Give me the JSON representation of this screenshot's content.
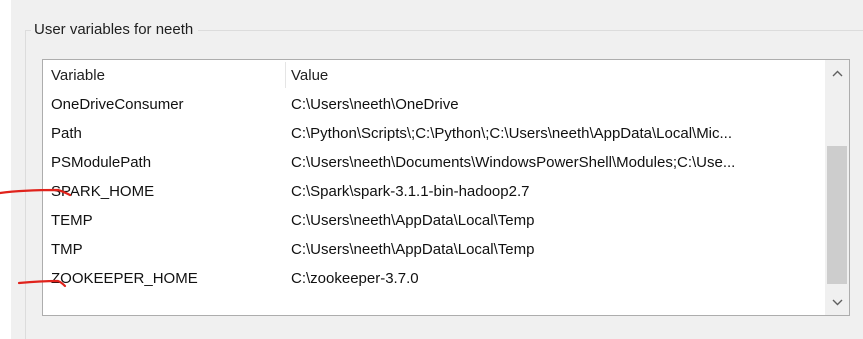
{
  "group": {
    "title": "User variables for neeth"
  },
  "columns": {
    "variable": "Variable",
    "value": "Value"
  },
  "rows": [
    {
      "variable": "OneDriveConsumer",
      "value": "C:\\Users\\neeth\\OneDrive"
    },
    {
      "variable": "Path",
      "value": "C:\\Python\\Scripts\\;C:\\Python\\;C:\\Users\\neeth\\AppData\\Local\\Mic..."
    },
    {
      "variable": "PSModulePath",
      "value": "C:\\Users\\neeth\\Documents\\WindowsPowerShell\\Modules;C:\\Use..."
    },
    {
      "variable": "SPARK_HOME",
      "value": "C:\\Spark\\spark-3.1.1-bin-hadoop2.7"
    },
    {
      "variable": "TEMP",
      "value": "C:\\Users\\neeth\\AppData\\Local\\Temp"
    },
    {
      "variable": "TMP",
      "value": "C:\\Users\\neeth\\AppData\\Local\\Temp"
    },
    {
      "variable": "ZOOKEEPER_HOME",
      "value": "C:\\zookeeper-3.7.0"
    }
  ],
  "scrollbar": {
    "up_icon": "chevron-up-icon",
    "down_icon": "chevron-down-icon"
  },
  "annotation": {
    "color": "#e0231c"
  }
}
